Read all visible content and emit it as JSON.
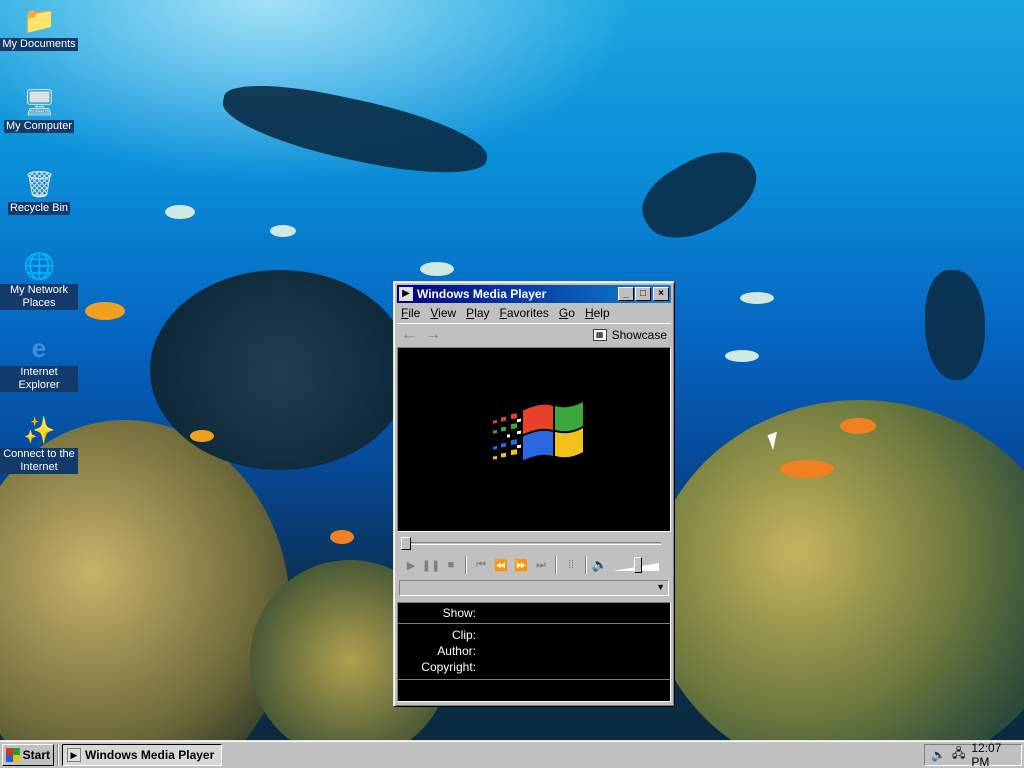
{
  "desktop": {
    "icons": [
      {
        "label": "My Documents",
        "icon": "folder-icon"
      },
      {
        "label": "My Computer",
        "icon": "computer-icon"
      },
      {
        "label": "Recycle Bin",
        "icon": "recycle-bin-icon"
      },
      {
        "label": "My Network Places",
        "icon": "network-icon"
      },
      {
        "label": "Internet Explorer",
        "icon": "internet-explorer-icon"
      },
      {
        "label": "Connect to the Internet",
        "icon": "connect-wizard-icon"
      }
    ]
  },
  "window": {
    "title": "Windows Media Player",
    "minimize": "_",
    "maximize": "□",
    "close": "×",
    "menu": [
      "File",
      "View",
      "Play",
      "Favorites",
      "Go",
      "Help"
    ],
    "nav": {
      "back": "←",
      "forward": "→",
      "showcase": "Showcase"
    },
    "controls": {
      "play": "▶",
      "pause": "❚❚",
      "stop": "■",
      "skip_back": "⏮",
      "rewind": "⏪",
      "fast_forward": "⏩",
      "skip_forward": "⏭",
      "playlist": "⁞⁞",
      "mute": "🔈"
    },
    "volume_level": 0.55,
    "seek_position": 0,
    "info": {
      "show_label": "Show:",
      "clip_label": "Clip:",
      "author_label": "Author:",
      "copyright_label": "Copyright:"
    }
  },
  "taskbar": {
    "start_label": "Start",
    "task_label": "Windows Media Player",
    "clock": "12:07 PM"
  },
  "colors": {
    "titlebar_start": "#000080",
    "titlebar_end": "#1084d0",
    "face": "#c0c0c0"
  }
}
